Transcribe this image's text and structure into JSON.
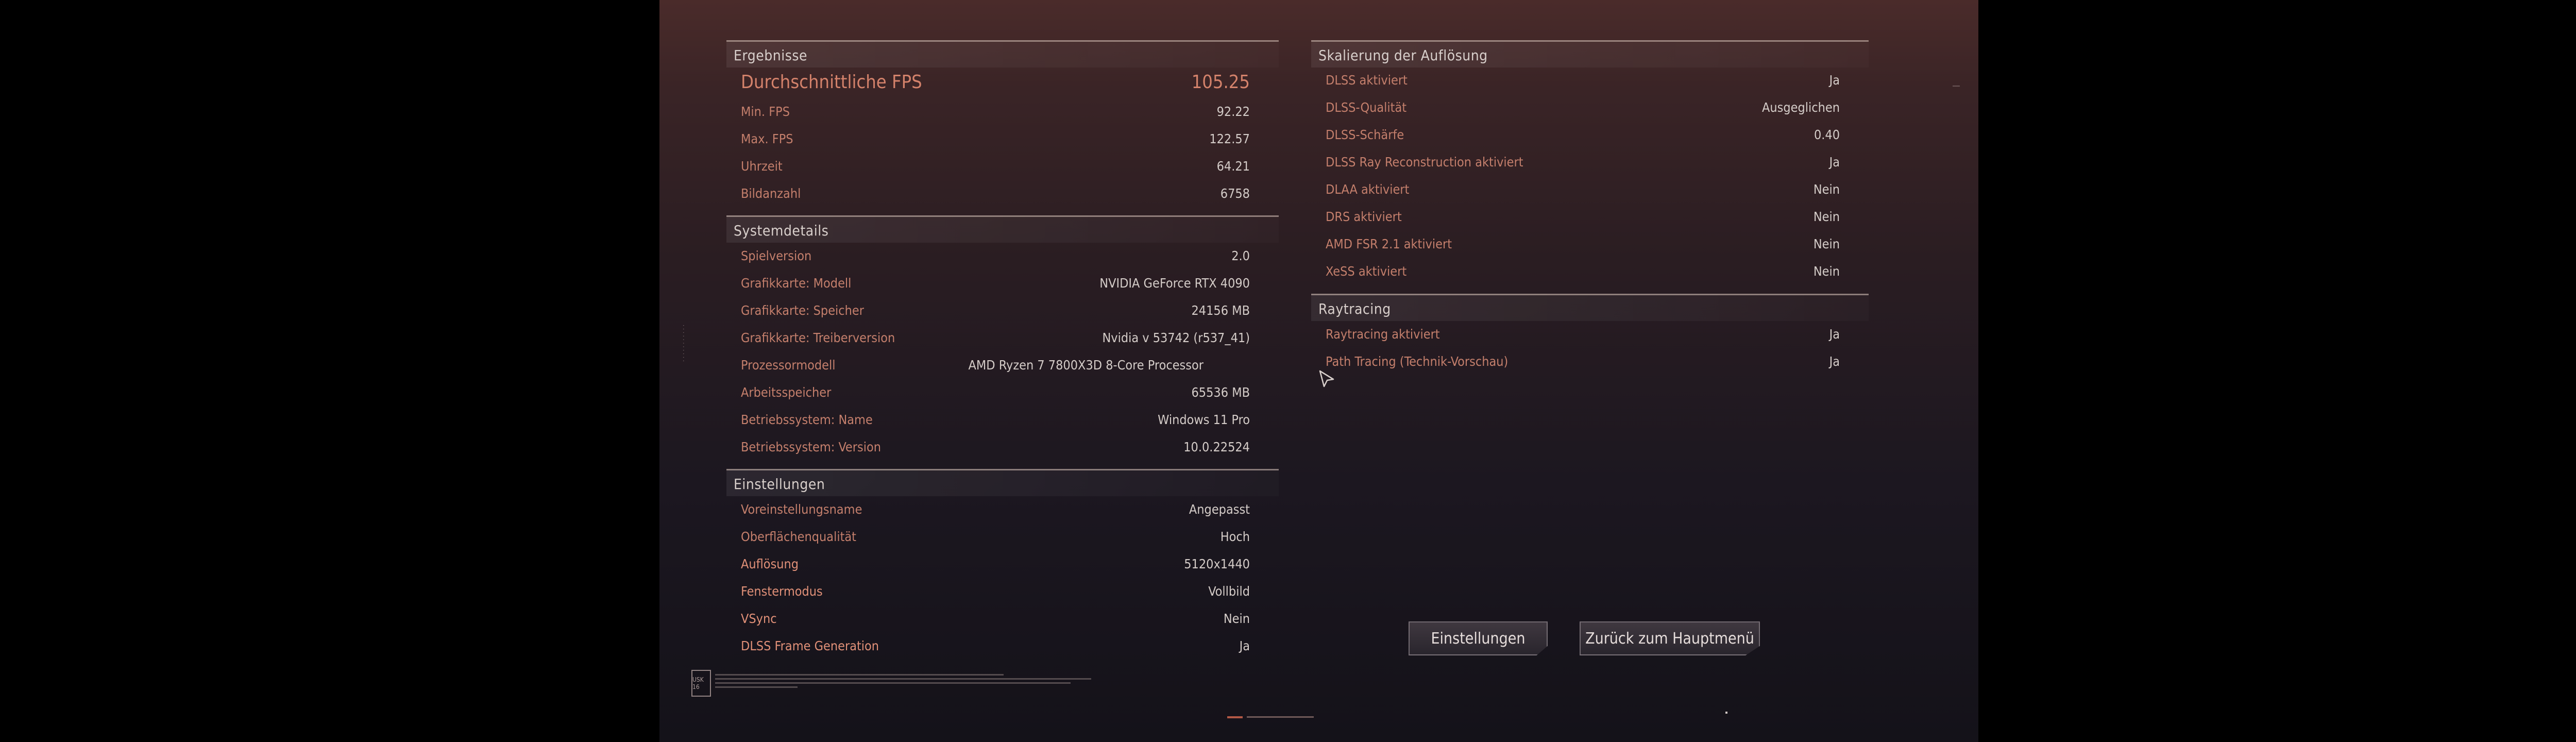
{
  "results": {
    "title": "Ergebnisse",
    "avg_fps_label": "Durchschnittliche FPS",
    "avg_fps_value": "105.25",
    "rows": [
      {
        "label": "Min. FPS",
        "value": "92.22"
      },
      {
        "label": "Max. FPS",
        "value": "122.57"
      },
      {
        "label": "Uhrzeit",
        "value": "64.21"
      },
      {
        "label": "Bildanzahl",
        "value": "6758"
      }
    ]
  },
  "system": {
    "title": "Systemdetails",
    "rows": [
      {
        "label": "Spielversion",
        "value": "2.0"
      },
      {
        "label": "Grafikkarte: Modell",
        "value": "NVIDIA GeForce RTX 4090"
      },
      {
        "label": "Grafikkarte: Speicher",
        "value": "24156 MB"
      },
      {
        "label": "Grafikkarte: Treiberversion",
        "value": "Nvidia v 53742 (r537_41)"
      },
      {
        "label": "Prozessormodell",
        "value": "AMD Ryzen 7 7800X3D 8-Core Processor"
      },
      {
        "label": "Arbeitsspeicher",
        "value": "65536 MB"
      },
      {
        "label": "Betriebssystem: Name",
        "value": "Windows 11 Pro"
      },
      {
        "label": "Betriebssystem: Version",
        "value": "10.0.22524"
      }
    ]
  },
  "settings": {
    "title": "Einstellungen",
    "rows": [
      {
        "label": "Voreinstellungsname",
        "value": "Angepasst"
      },
      {
        "label": "Oberflächenqualität",
        "value": "Hoch"
      },
      {
        "label": "Auflösung",
        "value": "5120x1440"
      },
      {
        "label": "Fenstermodus",
        "value": "Vollbild"
      },
      {
        "label": "VSync",
        "value": "Nein"
      },
      {
        "label": "DLSS Frame Generation",
        "value": "Ja"
      }
    ]
  },
  "scaling": {
    "title": "Skalierung der Auflösung",
    "rows": [
      {
        "label": "DLSS aktiviert",
        "value": "Ja"
      },
      {
        "label": "DLSS-Qualität",
        "value": "Ausgeglichen"
      },
      {
        "label": "DLSS-Schärfe",
        "value": "0.40"
      },
      {
        "label": "DLSS Ray Reconstruction aktiviert",
        "value": "Ja"
      },
      {
        "label": "DLAA aktiviert",
        "value": "Nein"
      },
      {
        "label": "DRS aktiviert",
        "value": "Nein"
      },
      {
        "label": "AMD FSR 2.1 aktiviert",
        "value": "Nein"
      },
      {
        "label": "XeSS aktiviert",
        "value": "Nein"
      }
    ]
  },
  "raytracing": {
    "title": "Raytracing",
    "rows": [
      {
        "label": "Raytracing aktiviert",
        "value": "Ja"
      },
      {
        "label": "Path Tracing (Technik-Vorschau)",
        "value": "Ja"
      }
    ]
  },
  "buttons": {
    "settings_label": "Einstellungen",
    "back_label": "Zurück zum Hauptmenü"
  },
  "footer": {
    "rating_label": "USK 16"
  },
  "icons": {
    "cursor": "mouse-cursor-icon",
    "rating": "age-rating-icon"
  },
  "colors": {
    "label": "#c47f6c",
    "value": "#d4ccc8",
    "header": "#d8cfcb"
  }
}
